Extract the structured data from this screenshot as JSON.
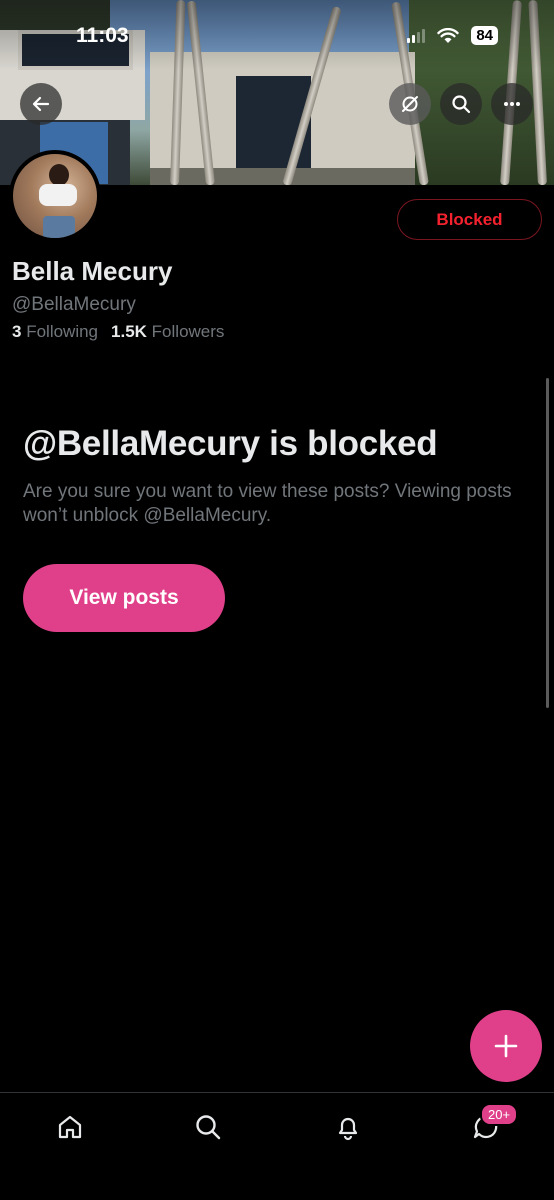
{
  "status_bar": {
    "time": "11:03",
    "battery": "84"
  },
  "header": {
    "back_icon": "arrow-left-icon",
    "grok_icon": "grok-icon",
    "search_icon": "search-icon",
    "more_icon": "more-horizontal-icon"
  },
  "profile": {
    "display_name": "Bella Mecury",
    "handle": "@BellaMecury",
    "following_count": "3",
    "following_label": "Following",
    "followers_count": "1.5K",
    "followers_label": "Followers",
    "blocked_button": "Blocked"
  },
  "blocked_notice": {
    "title": "@BellaMecury is blocked",
    "description": "Are you sure you want to view these posts? Viewing posts won’t unblock @BellaMecury.",
    "view_posts_button": "View posts"
  },
  "fab": {
    "icon": "plus-icon"
  },
  "bottom_nav": {
    "items": [
      {
        "icon": "home-icon"
      },
      {
        "icon": "search-icon"
      },
      {
        "icon": "bell-icon"
      },
      {
        "icon": "messages-icon"
      }
    ],
    "messages_badge": "20+"
  },
  "colors": {
    "accent": "#e0408a",
    "blocked_red": "#f4212e",
    "secondary_text": "#71767b",
    "primary_text": "#e7e9ea"
  }
}
